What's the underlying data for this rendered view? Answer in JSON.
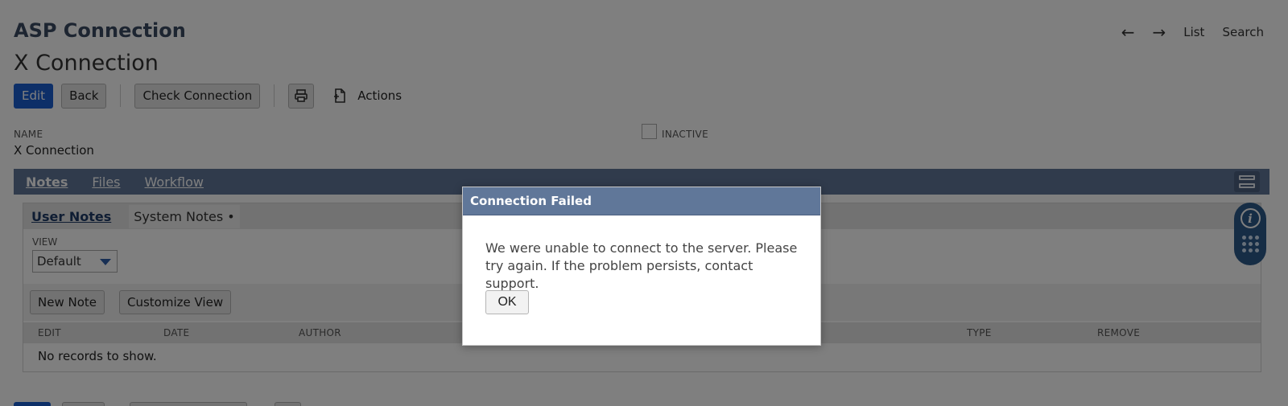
{
  "header": {
    "record_type": "ASP Connection",
    "record_name": "X Connection",
    "nav": {
      "list": "List",
      "search": "Search"
    }
  },
  "toolbar": {
    "edit": "Edit",
    "back": "Back",
    "check_connection": "Check Connection",
    "actions": "Actions"
  },
  "fields": {
    "name_label": "NAME",
    "name_value": "X Connection",
    "inactive_label": "INACTIVE",
    "inactive_checked": false
  },
  "tabs": [
    {
      "label": "Notes",
      "active": true
    },
    {
      "label": "Files",
      "active": false
    },
    {
      "label": "Workflow",
      "active": false
    }
  ],
  "subtabs": [
    {
      "label": "User Notes",
      "active": true
    },
    {
      "label": "System Notes •",
      "active": false
    }
  ],
  "notes_list": {
    "view_label": "VIEW",
    "view_value": "Default",
    "new_note": "New Note",
    "customize_view": "Customize View",
    "columns": [
      "EDIT",
      "DATE",
      "AUTHOR",
      "TYPE",
      "REMOVE"
    ],
    "empty_text": "No records to show."
  },
  "modal": {
    "title": "Connection Failed",
    "message": "We were unable to connect to the server. Please try again. If the problem persists, contact support.",
    "ok": "OK"
  },
  "colors": {
    "primary_button": "#1b5fd0",
    "tab_strip": "#607799",
    "modal_header": "#607799",
    "help_widget": "#2d5a8a"
  },
  "icons": [
    "arrow-left-icon",
    "arrow-right-icon",
    "print-icon",
    "new-document-icon",
    "collapse-tabs-icon",
    "info-icon",
    "dots-grid-icon",
    "dropdown-caret-icon"
  ]
}
